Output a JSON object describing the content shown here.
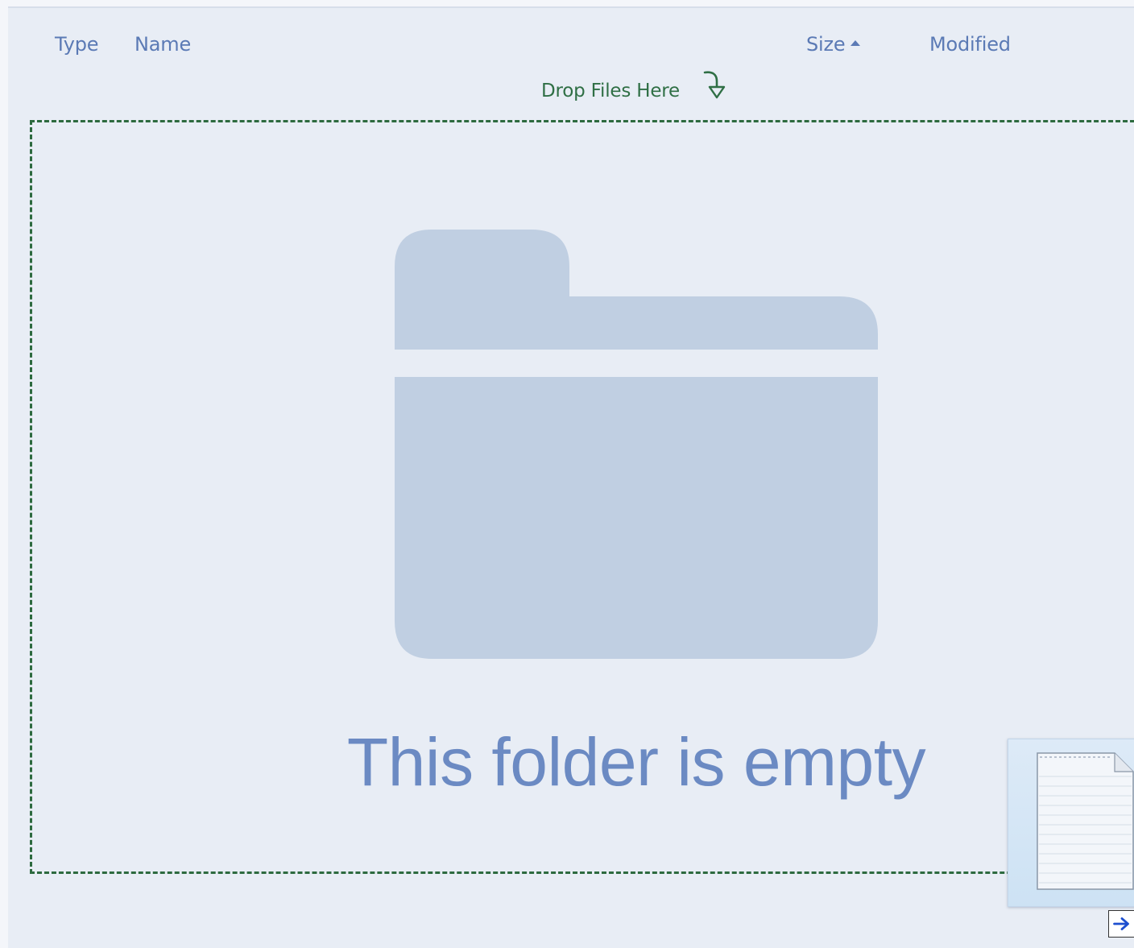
{
  "columns": {
    "type": "Type",
    "name": "Name",
    "size": "Size",
    "modified": "Modified"
  },
  "sort": {
    "column": "size",
    "direction": "ascending"
  },
  "drop_hint": "Drop Files Here",
  "empty_message": "This folder is empty",
  "icons": {
    "empty_state": "folder-icon",
    "drop_hint": "curved-arrow-down-icon",
    "drag_item": "document-icon",
    "cursor": "move-arrow-icon"
  },
  "colors": {
    "header_text": "#5b7ab5",
    "drop_zone_border": "#2d6a3f",
    "drop_hint_text": "#2f6f45",
    "folder_icon": "#c0cfe2",
    "empty_text": "#6b8ac3",
    "background": "#e8edf5"
  }
}
